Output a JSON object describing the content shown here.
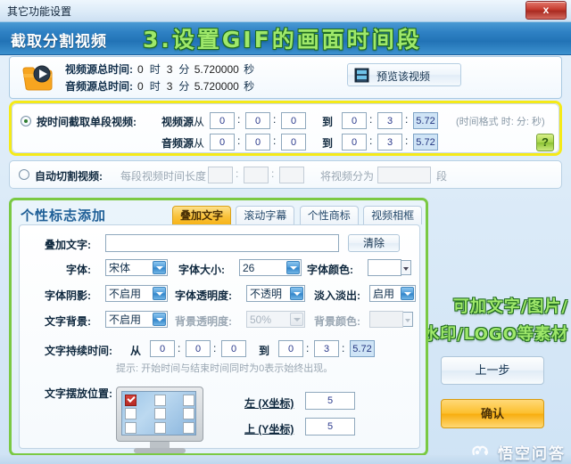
{
  "window": {
    "title": "其它功能设置",
    "close_label": "x"
  },
  "header": {
    "section_title": "截取分割视频",
    "annotation_top": "3.设置GIF的画面时间段",
    "annotation_side_line1": "可加文字/图片/",
    "annotation_side_line2": "水印/LOGO等素材"
  },
  "source_info": {
    "video_icon": "video-folder-icon",
    "video_row": {
      "label": "视频源总时间:",
      "hours": "0",
      "hours_unit": "时",
      "minutes": "3",
      "minutes_unit": "分",
      "seconds": "5.720000",
      "seconds_unit": "秒"
    },
    "audio_row": {
      "label": "音频源总时间:",
      "hours": "0",
      "hours_unit": "时",
      "minutes": "3",
      "minutes_unit": "分",
      "seconds": "5.720000",
      "seconds_unit": "秒"
    },
    "preview_button": "预览该视频",
    "preview_icon": "film-strip-icon"
  },
  "trim": {
    "radio_single_label": "按时间截取单段视频:",
    "radio_single_selected": true,
    "video_source_label": "视频源",
    "audio_source_label": "音频源",
    "from_label": "从",
    "to_label": "到",
    "format_hint": "(时间格式 时: 分: 秒)",
    "help_label": "?",
    "video": {
      "from_h": "0",
      "from_m": "0",
      "from_s": "0",
      "to_h": "0",
      "to_m": "3",
      "to_s": "5.72"
    },
    "audio": {
      "from_h": "0",
      "from_m": "0",
      "from_s": "0",
      "to_h": "0",
      "to_m": "3",
      "to_s": "5.72"
    }
  },
  "autosplit": {
    "radio_label": "自动切割视频:",
    "radio_selected": false,
    "segment_len_label": "每段视频时间长度",
    "seg_h": "",
    "seg_m": "",
    "seg_s": "",
    "divide_label": "将视频分为",
    "divide_count": "",
    "divide_unit": "段"
  },
  "logo_panel": {
    "title": "个性标志添加",
    "tabs": [
      {
        "label": "叠加文字",
        "active": true
      },
      {
        "label": "滚动字幕",
        "active": false
      },
      {
        "label": "个性商标",
        "active": false
      },
      {
        "label": "视频相框",
        "active": false
      }
    ],
    "overlay_text_label": "叠加文字:",
    "overlay_text_value": "",
    "clear_button": "清除",
    "font_label": "字体:",
    "font_value": "宋体",
    "font_size_label": "字体大小:",
    "font_size_value": "26",
    "font_color_label": "字体颜色:",
    "font_color_value": "#ffffff",
    "font_shadow_label": "字体阴影:",
    "font_shadow_value": "不启用",
    "font_opacity_label": "字体透明度:",
    "font_opacity_value": "不透明",
    "fade_label": "淡入淡出:",
    "fade_value": "启用",
    "text_bg_label": "文字背景:",
    "text_bg_value": "不启用",
    "bg_opacity_label": "背景透明度:",
    "bg_opacity_value": "50%",
    "bg_color_label": "背景颜色:",
    "duration_label": "文字持续时间:",
    "duration_from_label": "从",
    "duration_to_label": "到",
    "duration": {
      "from_h": "0",
      "from_m": "0",
      "from_s": "0",
      "to_h": "0",
      "to_m": "3",
      "to_s": "5.72"
    },
    "duration_hint": "提示: 开始时间与结束时间同时为0表示始终出现。",
    "position_label": "文字摆放位置:",
    "position_selected": "top-left",
    "left_label": "左 (X坐标)",
    "left_value": "5",
    "top_label": "上 (Y坐标)",
    "top_value": "5"
  },
  "actions": {
    "prev_button": "上一步",
    "confirm_button": "确认"
  },
  "watermark": {
    "text": "悟空问答",
    "icon": "wukong-logo-icon"
  },
  "colors": {
    "accent_blue": "#2f81c4",
    "highlight_yellow": "#f5ea18",
    "panel_green": "#7ac943",
    "confirm_orange": "#f7ae10",
    "annotation_green": "#9fe86a"
  }
}
